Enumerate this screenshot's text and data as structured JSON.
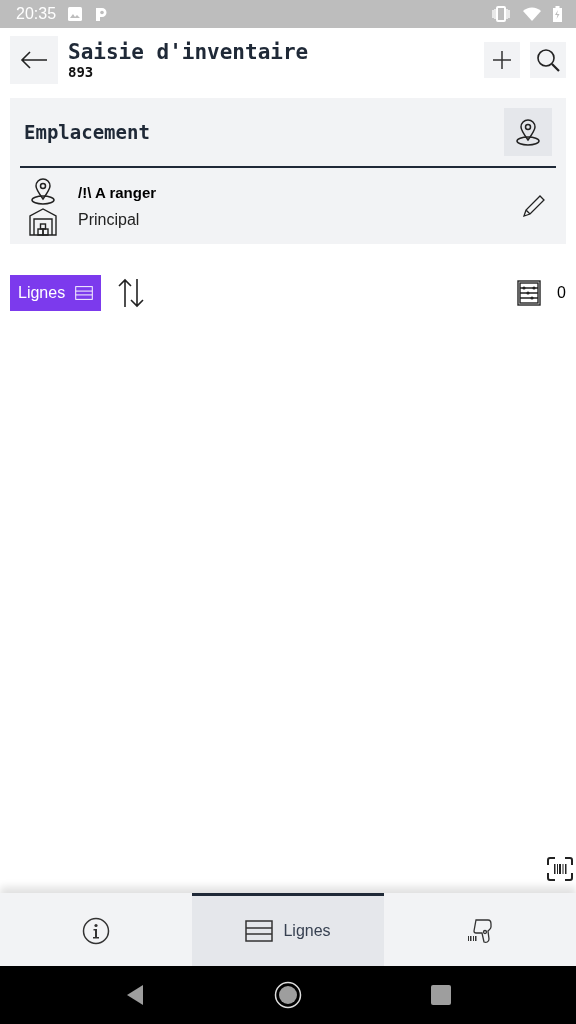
{
  "status_bar": {
    "time": "20:35"
  },
  "header": {
    "title": "Saisie d'inventaire",
    "subtitle": "893"
  },
  "location": {
    "heading": "Emplacement",
    "name": "/!\\ A ranger",
    "warehouse": "Principal"
  },
  "lines_bar": {
    "button": "Lignes",
    "count": "0"
  },
  "tabs": [
    {
      "kind": "info",
      "selected": false
    },
    {
      "kind": "lines",
      "label": "Lignes",
      "selected": true
    },
    {
      "kind": "scanner",
      "selected": false
    }
  ]
}
